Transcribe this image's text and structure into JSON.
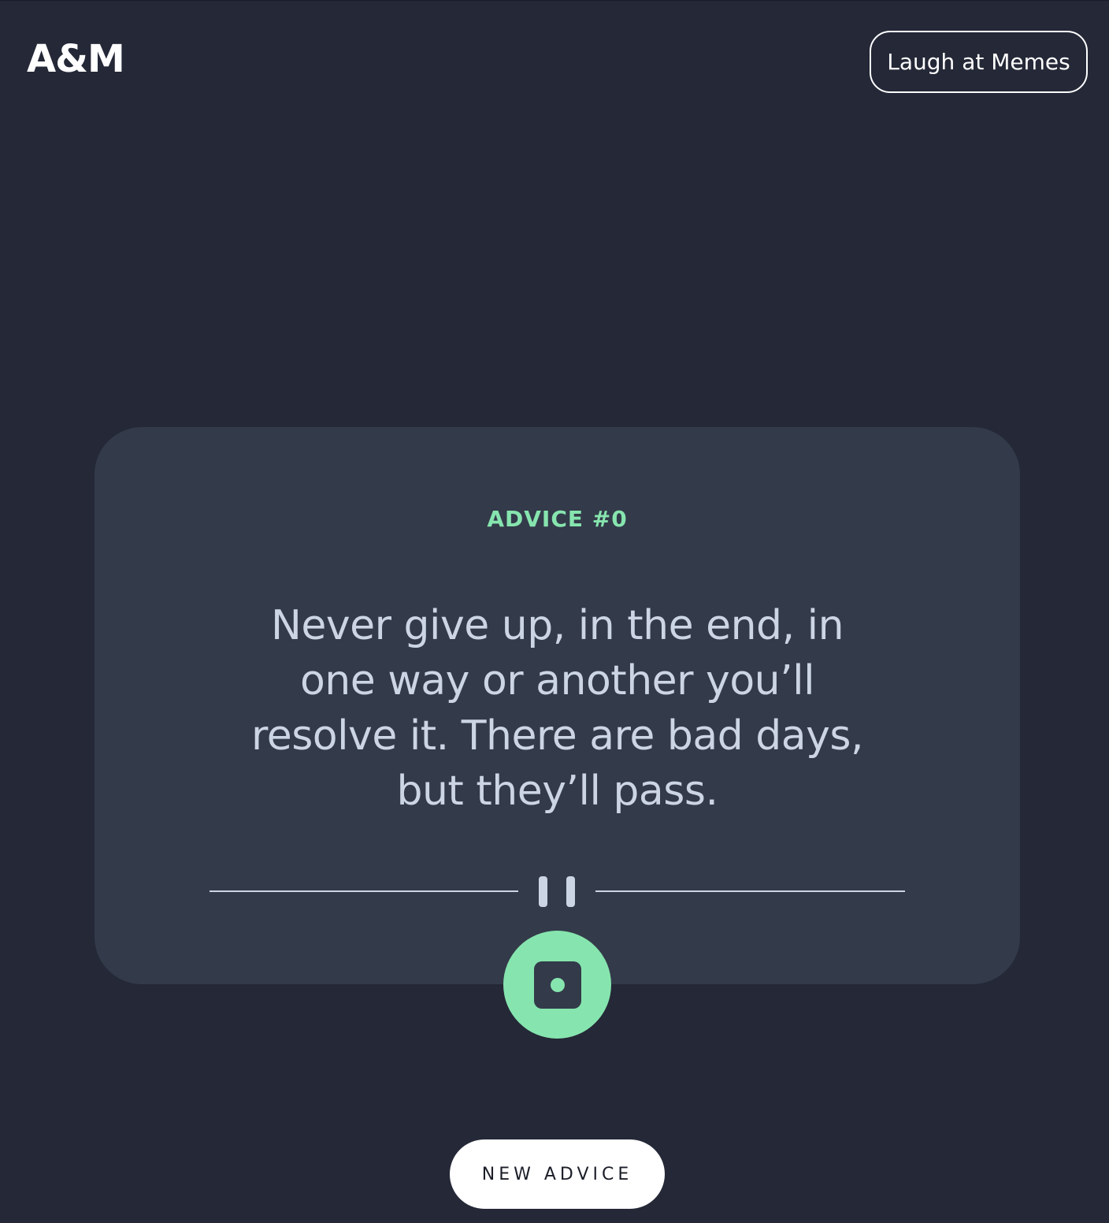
{
  "header": {
    "logo": "A&M",
    "nav_button_label": "Laugh at Memes"
  },
  "card": {
    "advice_label": "ADVICE #0",
    "advice_text": "Never give up, in the end, in one way or another you’ll resolve it. There are bad days, but they’ll pass.",
    "divider_icon": "pause-icon",
    "dice_icon": "dice-icon"
  },
  "actions": {
    "new_advice_label": "NEW ADVICE"
  },
  "colors": {
    "background": "#242837",
    "card": "#333a4a",
    "accent": "#86e5ae",
    "text": "#ccd5e3"
  }
}
